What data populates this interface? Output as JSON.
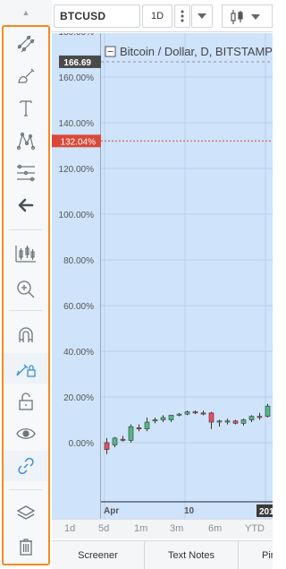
{
  "header": {
    "symbol": "BTCUSD",
    "resolution": "1D"
  },
  "chart": {
    "legend_title": "Bitcoin / Dollar, D, BITSTAMP",
    "price_labels": [
      "180.00%",
      "160.00%",
      "140.00%",
      "120.00%",
      "100.00%",
      "80.00%",
      "60.00%",
      "40.00%",
      "20.00%",
      "0.00%"
    ],
    "crosshair_value": "166.69",
    "last_value_label": "132.04%",
    "x_labels": [
      "Apr",
      "10",
      "201"
    ],
    "colors": {
      "background": "#cfe3fa",
      "up_candle": "#53b987",
      "down_candle": "#eb4d5c",
      "last_value_bg": "#d9493a",
      "crosshair_bg": "#4a4a4a",
      "toolbar_highlight": "#f5891f"
    }
  },
  "chart_data": {
    "type": "candlestick",
    "y_unit": "%",
    "ylim": [
      -8,
      190
    ],
    "y_ticks": [
      0,
      20,
      40,
      60,
      80,
      100,
      120,
      140,
      160,
      180
    ],
    "x_tick_labels": [
      "Apr",
      "10",
      "201"
    ],
    "crosshair_y": 166.69,
    "last_value": 132.04,
    "candles": [
      {
        "o": 0,
        "h": 2,
        "l": -5,
        "c": -3
      },
      {
        "o": -1,
        "h": 2.5,
        "l": -2,
        "c": 2
      },
      {
        "o": 1.5,
        "h": 3,
        "l": 0.5,
        "c": 1
      },
      {
        "o": 1,
        "h": 8,
        "l": 0,
        "c": 7
      },
      {
        "o": 6.5,
        "h": 8,
        "l": 5,
        "c": 6
      },
      {
        "o": 6,
        "h": 11,
        "l": 5,
        "c": 9
      },
      {
        "o": 9.5,
        "h": 11,
        "l": 8.5,
        "c": 10
      },
      {
        "o": 10,
        "h": 12,
        "l": 9,
        "c": 11
      },
      {
        "o": 10,
        "h": 12,
        "l": 9,
        "c": 12
      },
      {
        "o": 12,
        "h": 13,
        "l": 11.5,
        "c": 12.5
      },
      {
        "o": 12.5,
        "h": 14,
        "l": 12,
        "c": 13.5
      },
      {
        "o": 13.5,
        "h": 14,
        "l": 12.5,
        "c": 13
      },
      {
        "o": 13,
        "h": 14,
        "l": 12,
        "c": 12.5
      },
      {
        "o": 13,
        "h": 13.5,
        "l": 6,
        "c": 9
      },
      {
        "o": 9,
        "h": 10,
        "l": 7,
        "c": 9.5
      },
      {
        "o": 9,
        "h": 10.5,
        "l": 8,
        "c": 9.5
      },
      {
        "o": 9.5,
        "h": 10,
        "l": 8,
        "c": 8.5
      },
      {
        "o": 8.5,
        "h": 10.5,
        "l": 7.5,
        "c": 10
      },
      {
        "o": 10,
        "h": 12,
        "l": 9,
        "c": 11.5
      },
      {
        "o": 11.5,
        "h": 13,
        "l": 10,
        "c": 11
      },
      {
        "o": 11.5,
        "h": 17,
        "l": 11,
        "c": 16
      }
    ]
  },
  "timeframes": [
    "1d",
    "5d",
    "1m",
    "3m",
    "6m",
    "YTD"
  ],
  "tabs": [
    "Screener",
    "Text Notes",
    "Pine"
  ],
  "toolbar": {
    "icons": [
      "trend-line-icon",
      "brush-icon",
      "text-icon",
      "pattern-icon",
      "fib-icon",
      "back-arrow-icon",
      "measure-icon",
      "zoom-icon",
      "magnet-icon",
      "lock-drawing-icon",
      "unlock-icon",
      "eye-icon",
      "link-icon",
      "layers-icon",
      "trash-icon"
    ]
  }
}
